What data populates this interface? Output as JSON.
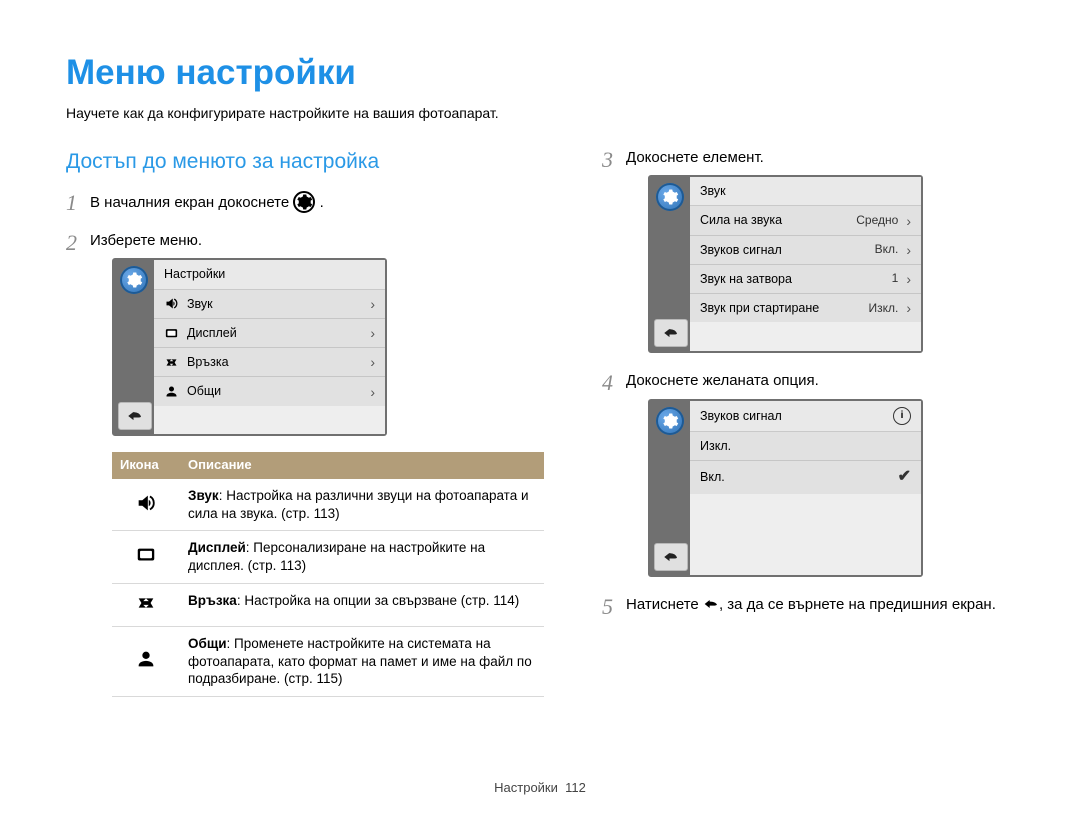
{
  "page": {
    "title": "Меню настройки",
    "subtitle": "Научете как да конфигурирате настройките на вашия фотоапарат.",
    "footer_label": "Настройки",
    "footer_page": "112"
  },
  "left": {
    "section_heading": "Достъп до менюто за настройка",
    "step1_before": "В началния екран докоснете ",
    "step1_after": ".",
    "step2": "Изберете меню.",
    "screen1": {
      "header": "Настройки",
      "items": [
        {
          "icon": "sound",
          "label": "Звук"
        },
        {
          "icon": "display",
          "label": "Дисплей"
        },
        {
          "icon": "connect",
          "label": "Връзка"
        },
        {
          "icon": "general",
          "label": "Общи"
        }
      ]
    },
    "table": {
      "head_icon": "Икона",
      "head_desc": "Описание",
      "rows": [
        {
          "icon": "sound",
          "label": "Звук",
          "text": ": Настройка на различни звуци на фотоапарата и сила на звука. (стр. 113)"
        },
        {
          "icon": "display",
          "label": "Дисплей",
          "text": ": Персонализиране на настройките на дисплея. (стр. 113)"
        },
        {
          "icon": "connect",
          "label": "Връзка",
          "text": ": Настройка на опции за свързване (стр. 114)"
        },
        {
          "icon": "general",
          "label": "Общи",
          "text": ": Променете настройките на системата на фотоапарата, като формат на памет и име на файл по подразбиране. (стр. 115)"
        }
      ]
    }
  },
  "right": {
    "step3": "Докоснете елемент.",
    "screen2": {
      "header": "Звук",
      "rows": [
        {
          "label": "Сила на звука",
          "value": "Средно"
        },
        {
          "label": "Звуков сигнал",
          "value": "Вкл."
        },
        {
          "label": "Звук на затвора",
          "value": "1"
        },
        {
          "label": "Звук при стартиране",
          "value": "Изкл."
        }
      ]
    },
    "step4": "Докоснете желаната опция.",
    "screen3": {
      "header": "Звуков сигнал",
      "options": [
        {
          "label": "Изкл.",
          "selected": false
        },
        {
          "label": "Вкл.",
          "selected": true
        }
      ]
    },
    "step5_before": "Натиснете ",
    "step5_after": ", за да се върнете на предишния екран."
  }
}
